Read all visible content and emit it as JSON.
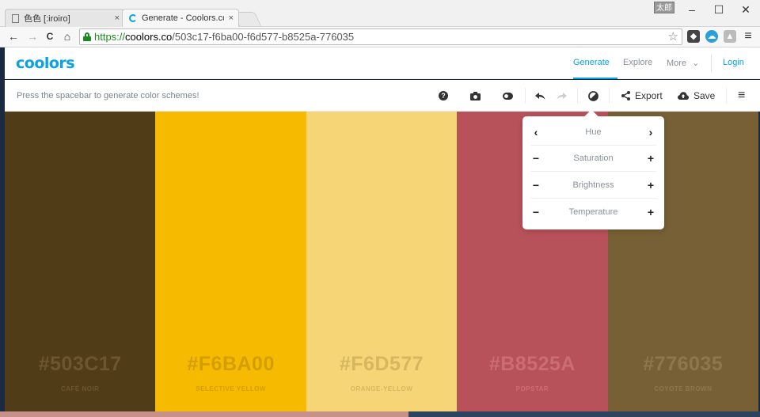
{
  "browser": {
    "tabs": [
      {
        "title": "色色 [:iroiro]",
        "close": "×"
      },
      {
        "title": "Generate - Coolors.co",
        "close": "×"
      }
    ],
    "user_badge": "太郎",
    "window_controls": {
      "minimize": "–",
      "maximize": "☐",
      "close": "✕"
    },
    "nav": {
      "back": "←",
      "forward": "→",
      "reload": "C",
      "home": "⌂"
    },
    "url": {
      "scheme": "https://",
      "host": "coolors.co",
      "path": "/503c17-f6ba00-f6d577-b8525a-776035"
    },
    "menu": "≡"
  },
  "app": {
    "logo": "coolors",
    "nav": {
      "generate": "Generate",
      "explore": "Explore",
      "more": "More",
      "more_chevron": "⌄",
      "login": "Login"
    },
    "hint": "Press the spacebar to generate color schemes!",
    "tools": {
      "help": "?",
      "export": "Export",
      "save": "Save",
      "menu": "≡"
    }
  },
  "palette": [
    {
      "hex": "#503C17",
      "name": "CAFÉ NOIR",
      "color": "#503c17",
      "text_color": "#6b5631"
    },
    {
      "hex": "#F6BA00",
      "name": "SELECTIVE YELLOW",
      "color": "#f6ba00",
      "text_color": "#d49e00"
    },
    {
      "hex": "#F6D577",
      "name": "ORANGE-YELLOW",
      "color": "#f6d577",
      "text_color": "#d6b65f"
    },
    {
      "hex": "#B8525A",
      "name": "POPSTAR",
      "color": "#b8525a",
      "text_color": "#cc6d74"
    },
    {
      "hex": "#776035",
      "name": "COYOTE BROWN",
      "color": "#776035",
      "text_color": "#8e774c"
    }
  ],
  "adjust_popup": {
    "rows": [
      {
        "left": "‹",
        "label": "Hue",
        "right": "›"
      },
      {
        "left": "−",
        "label": "Saturation",
        "right": "+"
      },
      {
        "left": "−",
        "label": "Brightness",
        "right": "+"
      },
      {
        "left": "−",
        "label": "Temperature",
        "right": "+"
      }
    ]
  },
  "colors": {
    "accent": "#0aa2e4",
    "text_muted": "#8a9099"
  }
}
